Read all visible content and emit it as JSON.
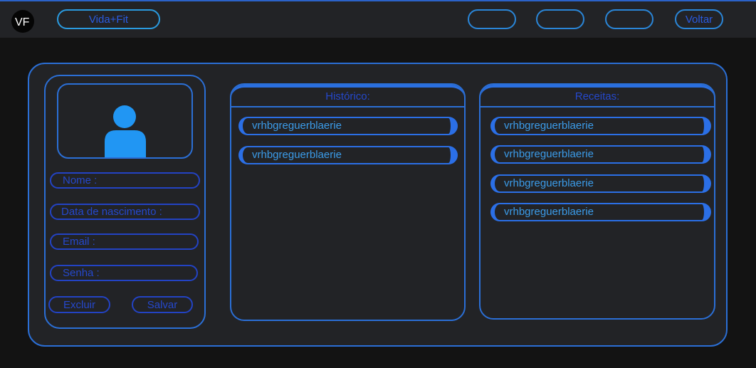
{
  "header": {
    "logo_text": "VF",
    "brand_label": "Vida+Fit",
    "nav_items": [
      "",
      "",
      ""
    ],
    "back_label": "Voltar"
  },
  "profile": {
    "fields": {
      "nome": "Nome :",
      "data_nascimento": "Data de nascimento :",
      "email": "Email :",
      "senha": "Senha :"
    },
    "delete_label": "Excluir",
    "save_label": "Salvar"
  },
  "historico": {
    "title": "Histórico:",
    "items": [
      "vrhbgreguerblaerie",
      "vrhbgreguerblaerie"
    ]
  },
  "receitas": {
    "title": "Receitas:",
    "items": [
      "vrhbgreguerblaerie",
      "vrhbgreguerblaerie",
      "vrhbgreguerblaerie",
      "vrhbgreguerblaerie"
    ]
  },
  "colors": {
    "accent": "#2b6fd6",
    "text_blue": "#2548cc",
    "item_text": "#3b9be8",
    "avatar": "#2196f3",
    "panel_bg": "#222326",
    "page_bg": "#131313"
  }
}
